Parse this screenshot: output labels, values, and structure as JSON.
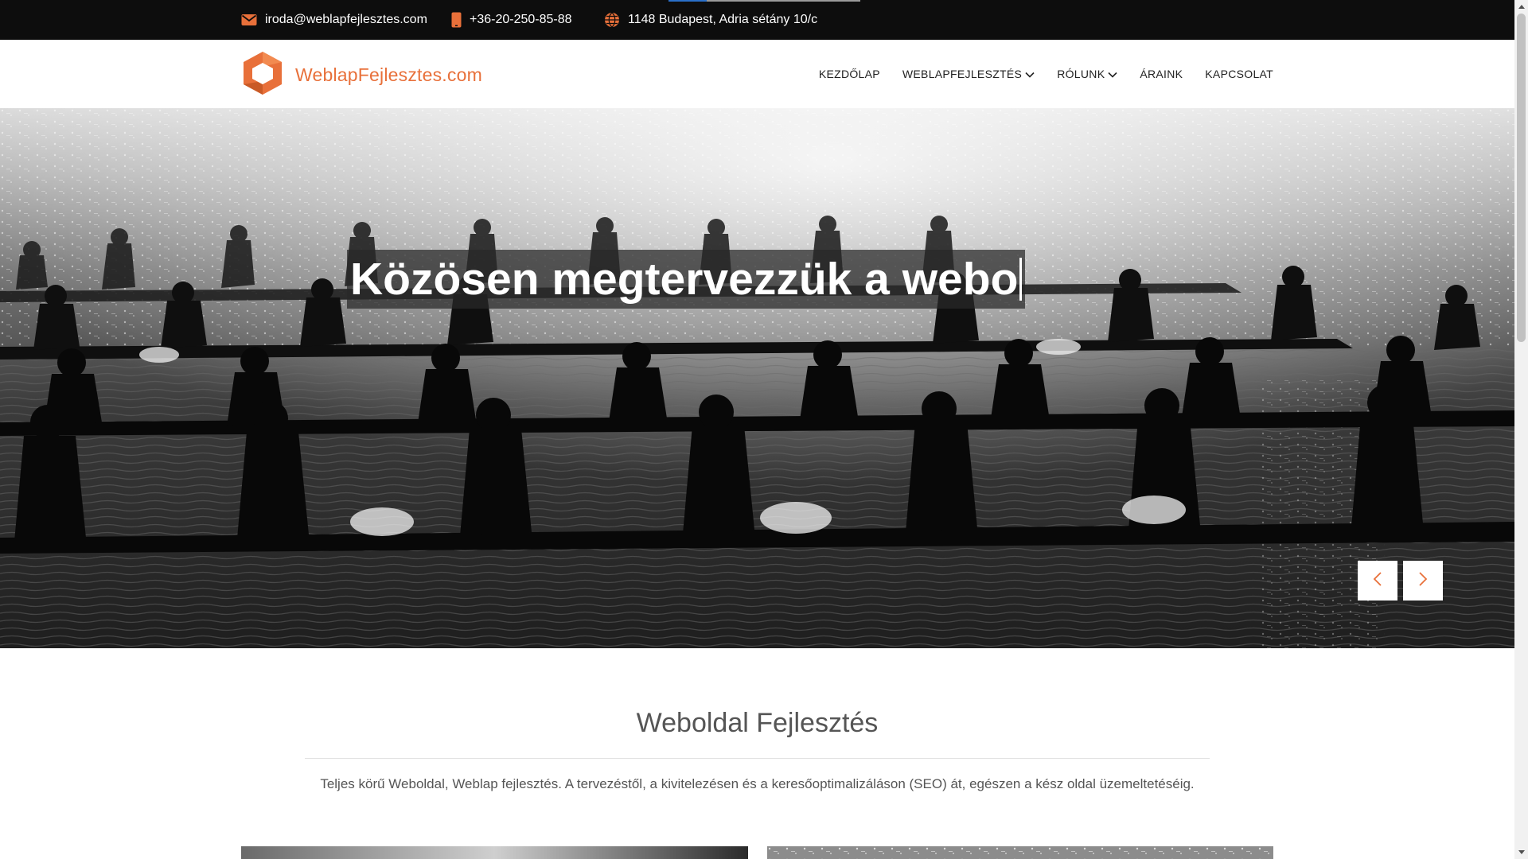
{
  "topbar": {
    "email": "iroda@weblapfejlesztes.com",
    "phone": "+36-20-250-85-88",
    "address": "1148 Budapest, Adria sétány 10/c",
    "icon_email": "envelope-icon",
    "icon_phone": "mobile-phone-icon",
    "icon_address": "globe-icon"
  },
  "header": {
    "logo_text": "WeblapFejlesztes.com",
    "logo_icon": "hexagon-logo-icon",
    "nav": [
      {
        "label": "KEZDŐLAP"
      },
      {
        "label": "WEBLAPFEJLESZTÉS"
      },
      {
        "label": "RÓLUNK"
      },
      {
        "label": "ÁRAINK"
      },
      {
        "label": "KAPCSOLAT"
      }
    ]
  },
  "hero": {
    "headline": "Közösen megtervezzük a webo",
    "prev_icon": "chevron-left-icon",
    "next_icon": "chevron-right-icon"
  },
  "section": {
    "title": "Weboldal Fejlesztés",
    "description": "Teljes körű Weboldal, Weblap fejlesztés. A tervezéstől, a kivitelezésen és a keresőoptimalizáláson (SEO) át, egészen a kész oldal üzemeltetéséig."
  },
  "colors": {
    "accent": "#e8703a",
    "topbar_bg": "#0d0d0d",
    "text_dark": "#222222"
  }
}
